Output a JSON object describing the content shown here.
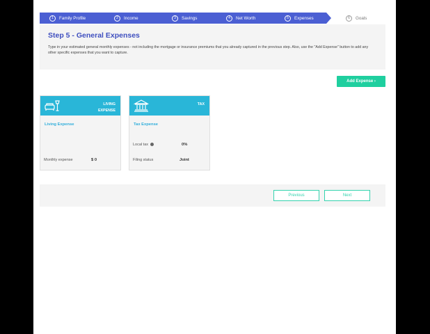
{
  "stepper": {
    "steps": [
      {
        "num": "1",
        "label": "Family Profile"
      },
      {
        "num": "2",
        "label": "Income"
      },
      {
        "num": "3",
        "label": "Savings"
      },
      {
        "num": "4",
        "label": "Net Worth"
      },
      {
        "num": "5",
        "label": "Expenses"
      },
      {
        "num": "6",
        "label": "Goals"
      }
    ],
    "active_color": "#4b5fd3"
  },
  "header": {
    "title": "Step 5 - General Expenses",
    "instructions": "Type in your estimated general monthly expenses - not including the mortgage or insurance premiums that you already captured in the previous step. Also, use the \"Add Expense\" button to add any other specific expenses that you want to capture."
  },
  "toolbar": {
    "add_expense_label": "Add Expense ›"
  },
  "cards": {
    "living": {
      "type_label": "LIVING EXPENSE",
      "icon": "sofa-lamp-icon",
      "name": "Living Expense",
      "monthly_label": "Monthly expense",
      "monthly_value": "$ 0"
    },
    "tax": {
      "type_label": "TAX",
      "icon": "bank-building-icon",
      "name": "Tax Expense",
      "local_tax_label": "Local tax",
      "local_tax_value": "0%",
      "filing_label": "Filing status",
      "filing_value": "Joint"
    }
  },
  "footer": {
    "previous_label": "Previous",
    "next_label": "Next"
  },
  "colors": {
    "card_header": "#29b6d8",
    "accent_green": "#1fcf9f",
    "title_blue": "#3f4fbf"
  }
}
